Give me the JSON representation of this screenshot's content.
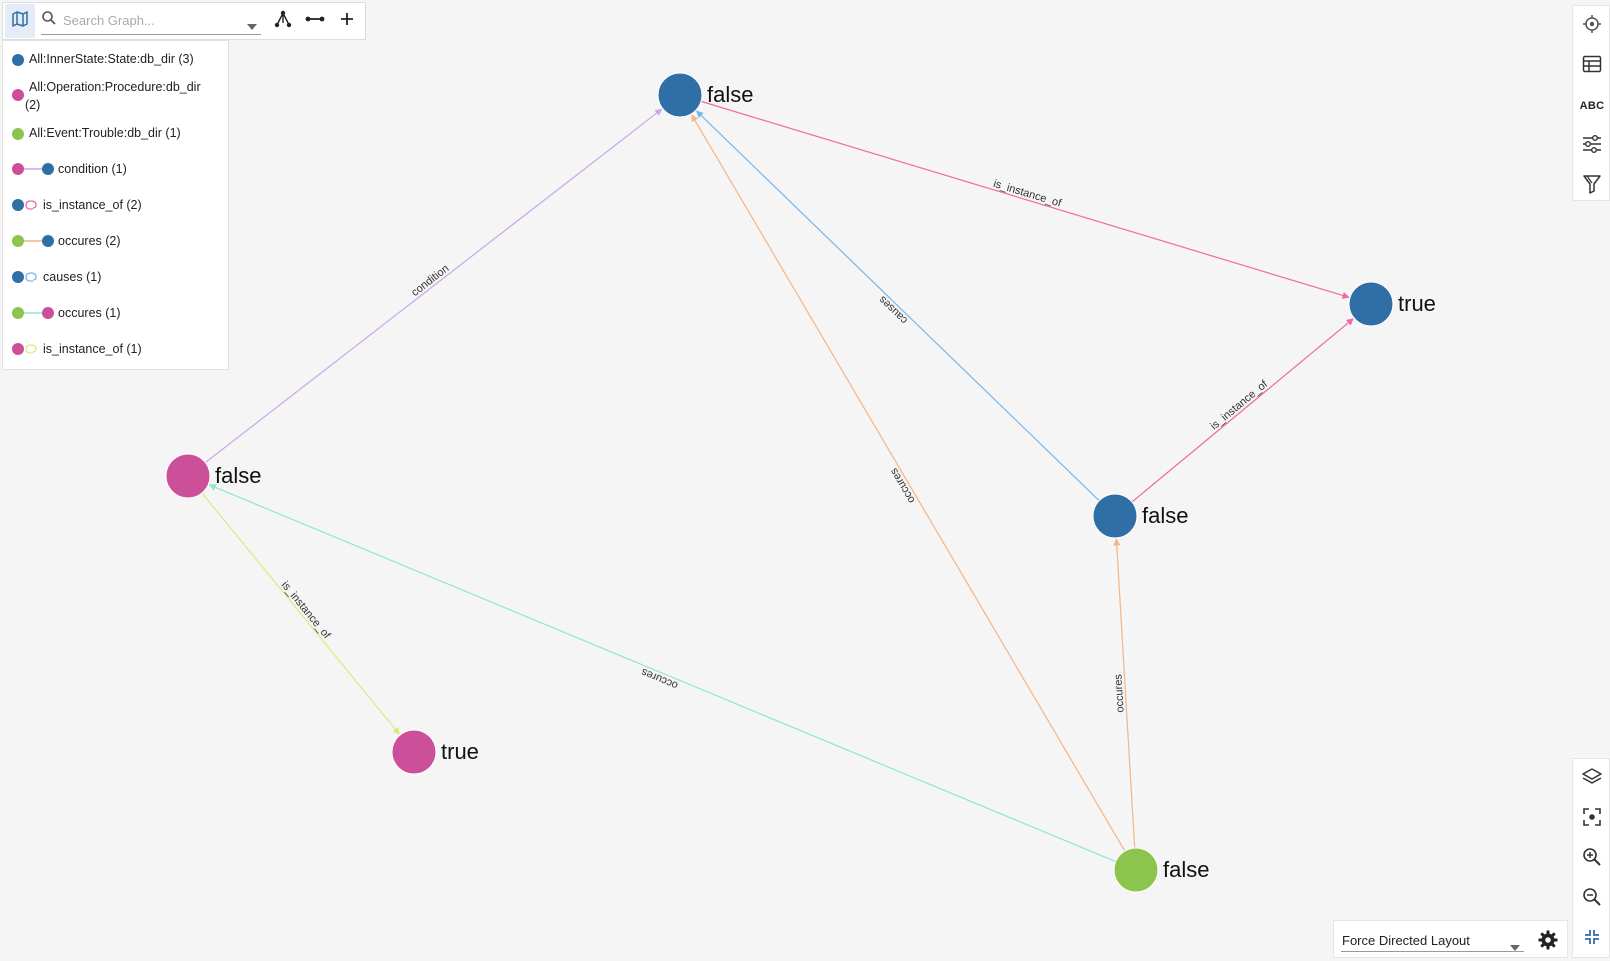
{
  "toolbar": {
    "search_placeholder": "Search Graph...",
    "map_icon": "map-icon",
    "search_icon": "search-icon",
    "dropdown_icon": "caret-down-icon",
    "hierarchy_icon": "hierarchy-icon",
    "edge_icon": "edge-icon",
    "add_icon": "plus-icon"
  },
  "legend": {
    "items": [
      {
        "label": "All:InnerState:State:db_dir (3)",
        "type": "node",
        "color": "#2f6fa6"
      },
      {
        "label": "All:Operation:Procedure:db_dir (2)",
        "type": "node",
        "color": "#cc4f99"
      },
      {
        "label": "All:Event:Trouble:db_dir (1)",
        "type": "node",
        "color": "#8dc44e"
      },
      {
        "label": "condition (1)",
        "type": "edge",
        "from_color": "#cc4f99",
        "to_color": "#2f6fa6",
        "line_color": "#c9a7ea"
      },
      {
        "label": "is_instance_of (2)",
        "type": "self",
        "from_color": "#2f6fa6",
        "line_color": "#ef6aa0"
      },
      {
        "label": "occures (2)",
        "type": "edge",
        "from_color": "#8dc44e",
        "to_color": "#2f6fa6",
        "line_color": "#f5b487"
      },
      {
        "label": "causes (1)",
        "type": "self",
        "from_color": "#2f6fa6",
        "line_color": "#7ab6e8"
      },
      {
        "label": "occures (1)",
        "type": "edge",
        "from_color": "#8dc44e",
        "to_color": "#cc4f99",
        "line_color": "#8ee8c8"
      },
      {
        "label": "is_instance_of (1)",
        "type": "self",
        "from_color": "#cc4f99",
        "line_color": "#d9ec7a"
      }
    ]
  },
  "graph": {
    "nodes": [
      {
        "id": "n1",
        "label": "false",
        "color": "#2f6fa6"
      },
      {
        "id": "n2",
        "label": "true",
        "color": "#2f6fa6"
      },
      {
        "id": "n3",
        "label": "false",
        "color": "#cc4f99"
      },
      {
        "id": "n4",
        "label": "false",
        "color": "#2f6fa6"
      },
      {
        "id": "n5",
        "label": "true",
        "color": "#cc4f99"
      },
      {
        "id": "n6",
        "label": "false",
        "color": "#8dc44e"
      }
    ],
    "edges": [
      {
        "from": "n3",
        "to": "n1",
        "label": "condition",
        "color": "#c9a7ea"
      },
      {
        "from": "n1",
        "to": "n2",
        "label": "is_instance_of",
        "color": "#ef6aa0"
      },
      {
        "from": "n4",
        "to": "n1",
        "label": "causes",
        "color": "#7ab6e8"
      },
      {
        "from": "n4",
        "to": "n2",
        "label": "is_instance_of",
        "color": "#ef6aa0"
      },
      {
        "from": "n6",
        "to": "n1",
        "label": "occures",
        "color": "#f5b487"
      },
      {
        "from": "n6",
        "to": "n4",
        "label": "occures",
        "color": "#f5b487"
      },
      {
        "from": "n6",
        "to": "n3",
        "label": "occures",
        "color": "#8ee8c8"
      },
      {
        "from": "n3",
        "to": "n5",
        "label": "is_instance_of",
        "color": "#d9ec7a"
      }
    ]
  },
  "right_top_panel": {
    "buttons": [
      "target-icon",
      "table-icon",
      "abc-icon",
      "sliders-icon",
      "filter-icon"
    ],
    "abc_text": "ABC"
  },
  "right_bottom_panel": {
    "buttons": [
      "layers-icon",
      "fit-screen-icon",
      "zoom-in-icon",
      "zoom-out-icon",
      "collapse-icon"
    ]
  },
  "layout": {
    "selected": "Force Directed Layout",
    "settings_icon": "gear-icon"
  }
}
